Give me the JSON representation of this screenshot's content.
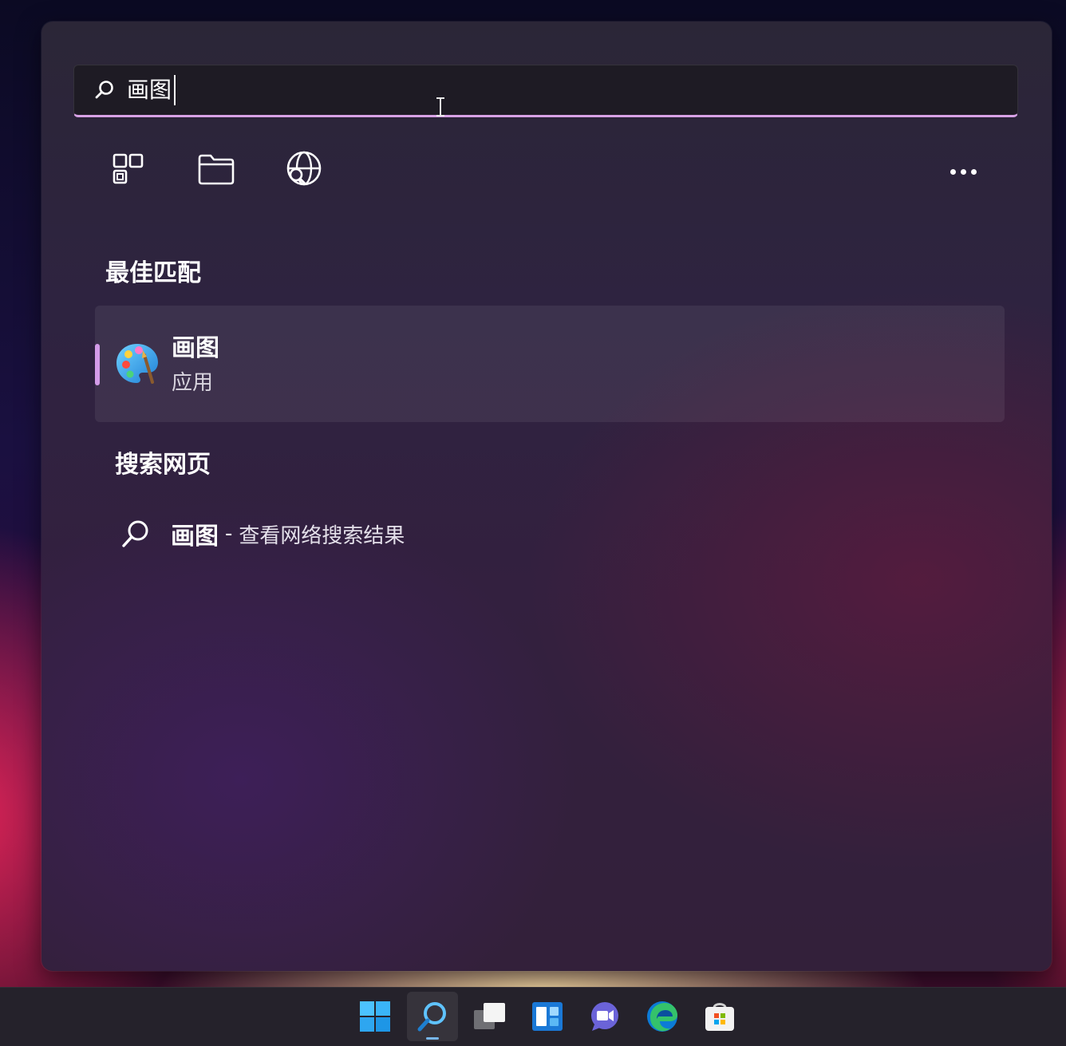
{
  "search": {
    "query": "画图"
  },
  "filters": {
    "apps_icon": "apps-grid-icon",
    "documents_icon": "folder-icon",
    "web_icon": "globe-search-icon",
    "more_icon": "more-ellipsis-icon"
  },
  "best_match": {
    "heading": "最佳匹配",
    "app_name": "画图",
    "app_type": "应用",
    "icon": "paint-palette-icon"
  },
  "web_search": {
    "heading": "搜索网页",
    "query": "画图",
    "separator": "-",
    "hint": "查看网络搜索结果"
  },
  "taskbar": {
    "items": [
      "start",
      "search",
      "task-view",
      "widgets",
      "chat",
      "edge",
      "store"
    ],
    "active": "search"
  },
  "colors": {
    "accent": "#d39be8",
    "search_underline": "#d8a2e6",
    "taskbar_bg": "#25222b"
  }
}
